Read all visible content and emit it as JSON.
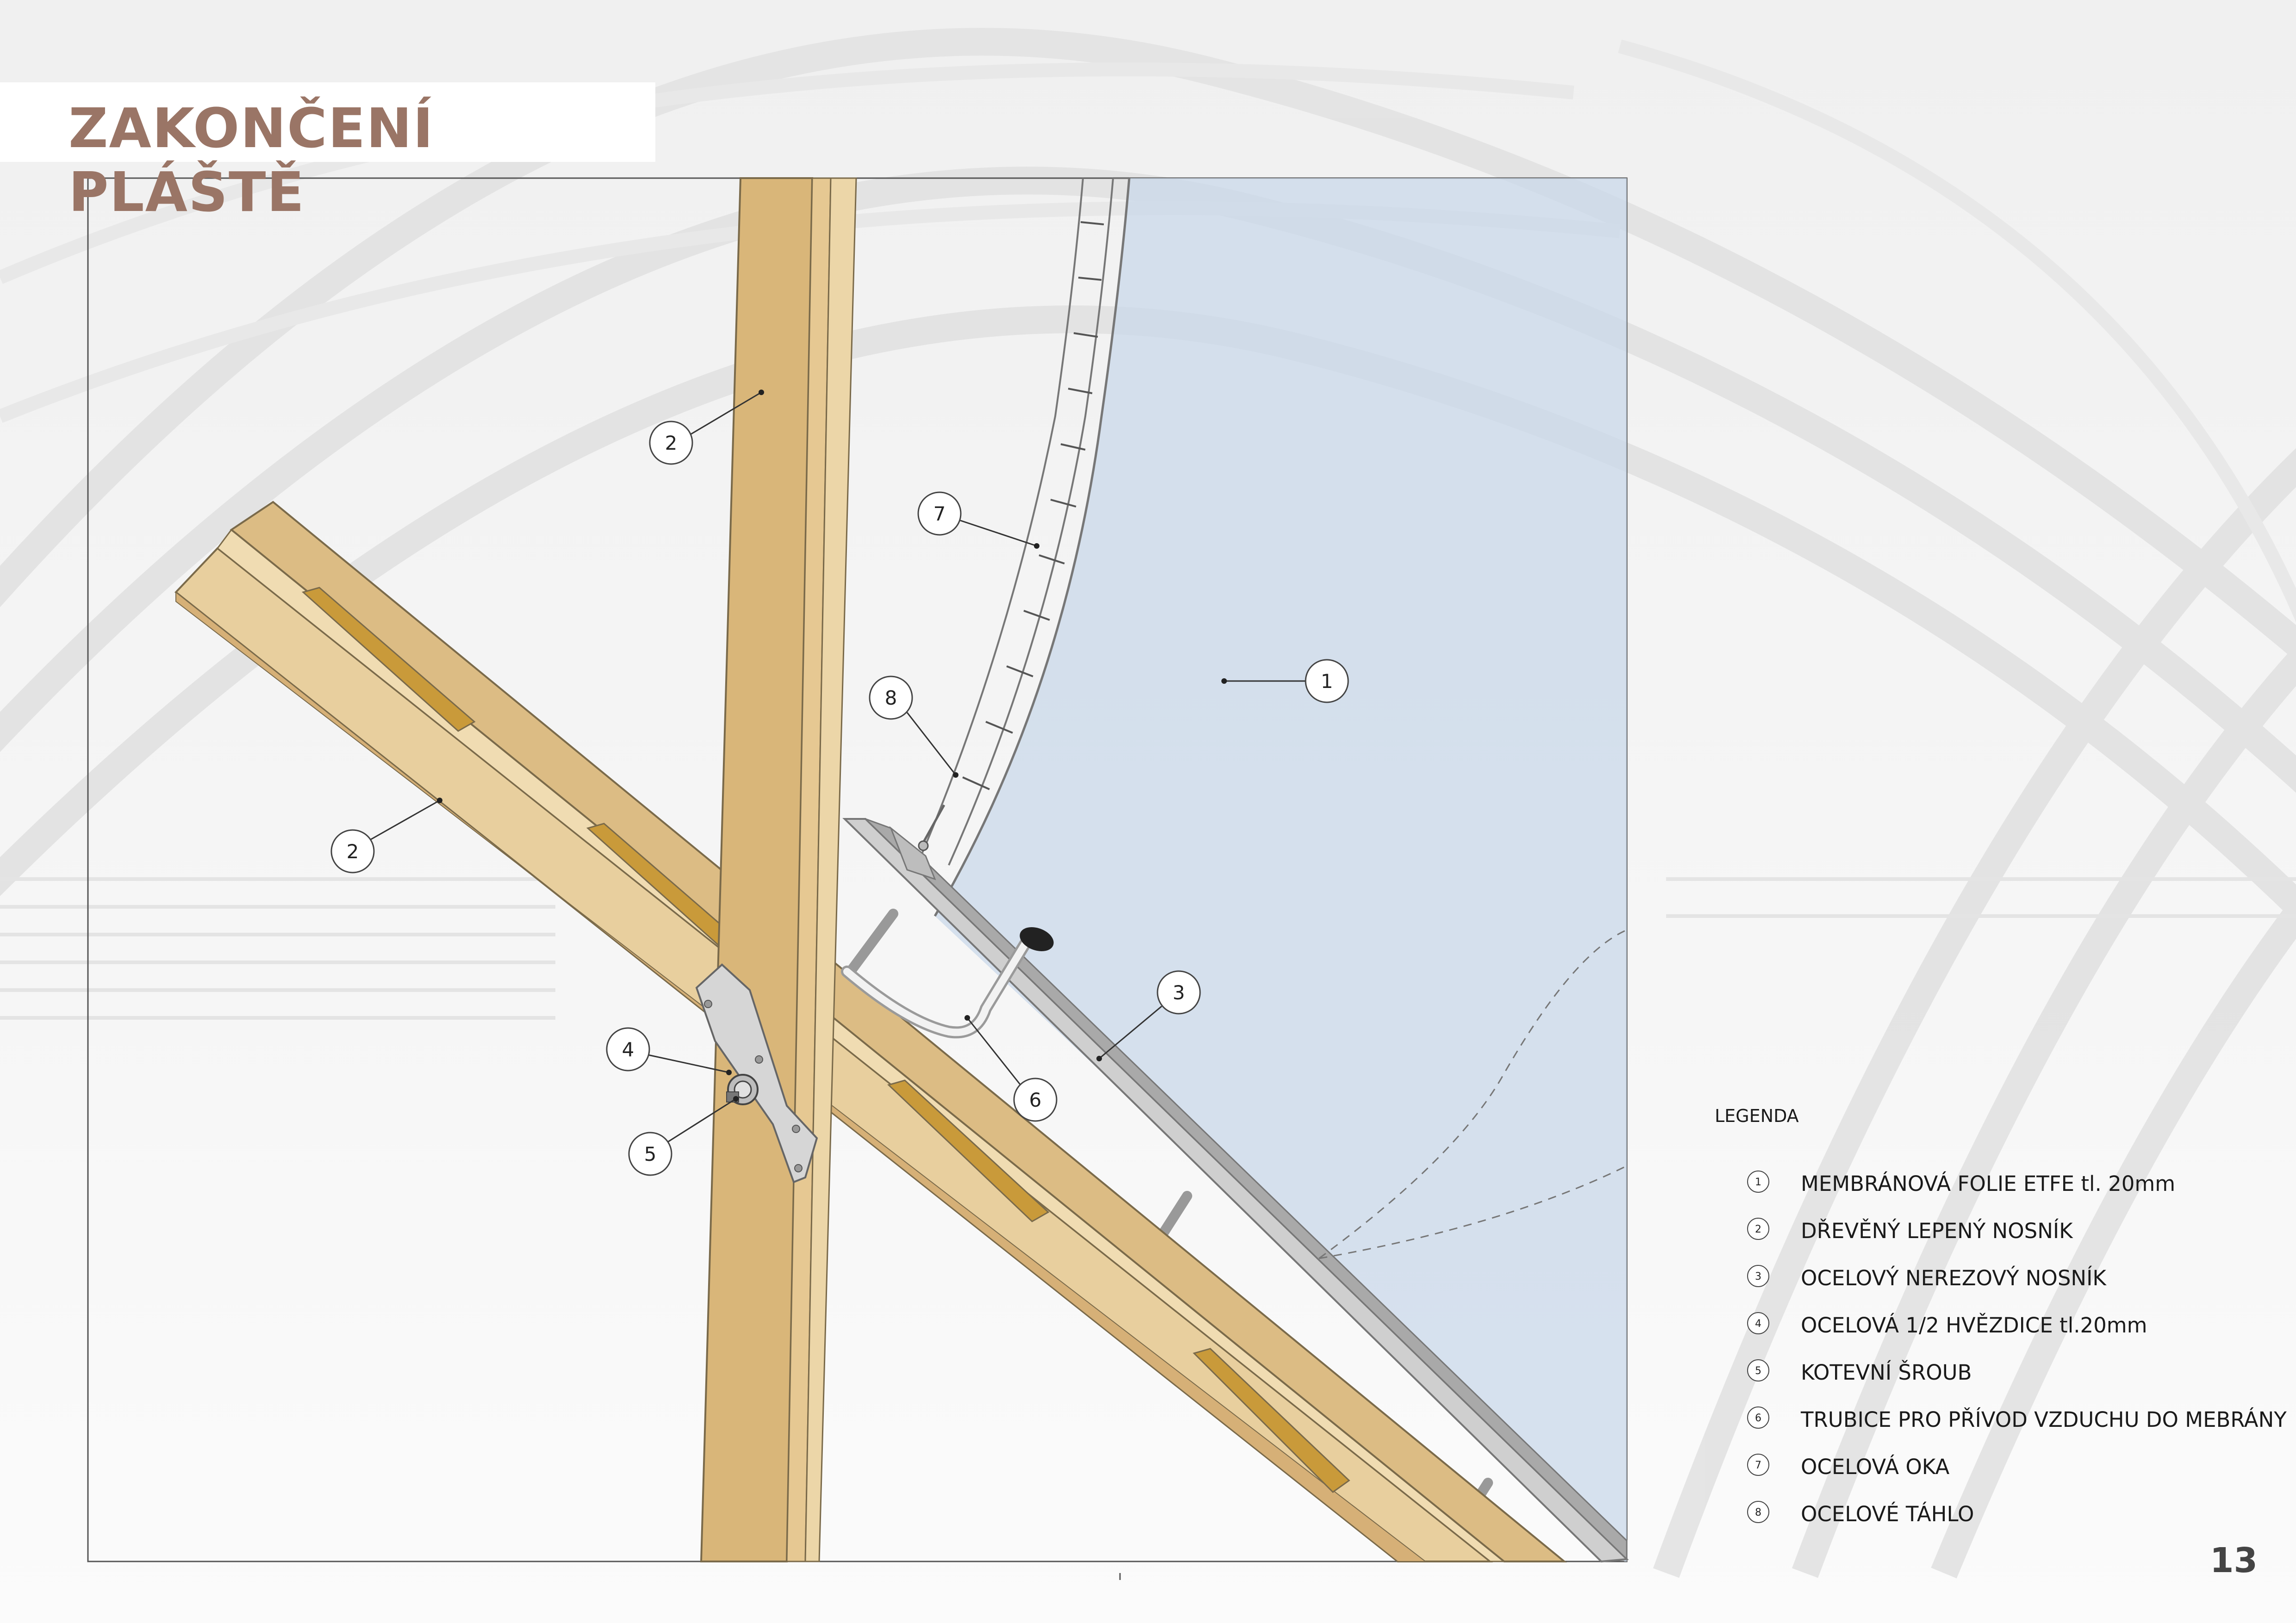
{
  "title": "ZAKONČENÍ PLÁŠTĚ",
  "page_number": "13",
  "legend": {
    "heading": "LEGENDA",
    "items": [
      {
        "num": "1",
        "text": "MEMBRÁNOVÁ FOLIE ETFE tl. 20mm"
      },
      {
        "num": "2",
        "text": "DŘEVĚNÝ LEPENÝ NOSNÍK"
      },
      {
        "num": "3",
        "text": "OCELOVÝ NEREZOVÝ NOSNÍK"
      },
      {
        "num": "4",
        "text": "OCELOVÁ 1/2 HVĚZDICE tl.20mm"
      },
      {
        "num": "5",
        "text": "KOTEVNÍ ŠROUB"
      },
      {
        "num": "6",
        "text": "TRUBICE PRO PŘÍVOD VZDUCHU DO MEBRÁNY"
      },
      {
        "num": "7",
        "text": "OCELOVÁ OKA"
      },
      {
        "num": "8",
        "text": "OCELOVÉ TÁHLO"
      }
    ]
  },
  "callouts": {
    "c1": "1",
    "c2a": "2",
    "c2b": "2",
    "c3": "3",
    "c4": "4",
    "c5": "5",
    "c6": "6",
    "c7": "7",
    "c8": "8"
  },
  "colors": {
    "title": "#9a7566",
    "timber": "#d9b679",
    "timber_light": "#ecd6a8",
    "timber_dark": "#c9a060",
    "slot": "#c99a3a",
    "membrane": "#c9d8ea",
    "steel": "#c8c8c8"
  },
  "icons": [
    "numbered-callout-circle",
    "bolt",
    "air-pipe-nozzle"
  ]
}
